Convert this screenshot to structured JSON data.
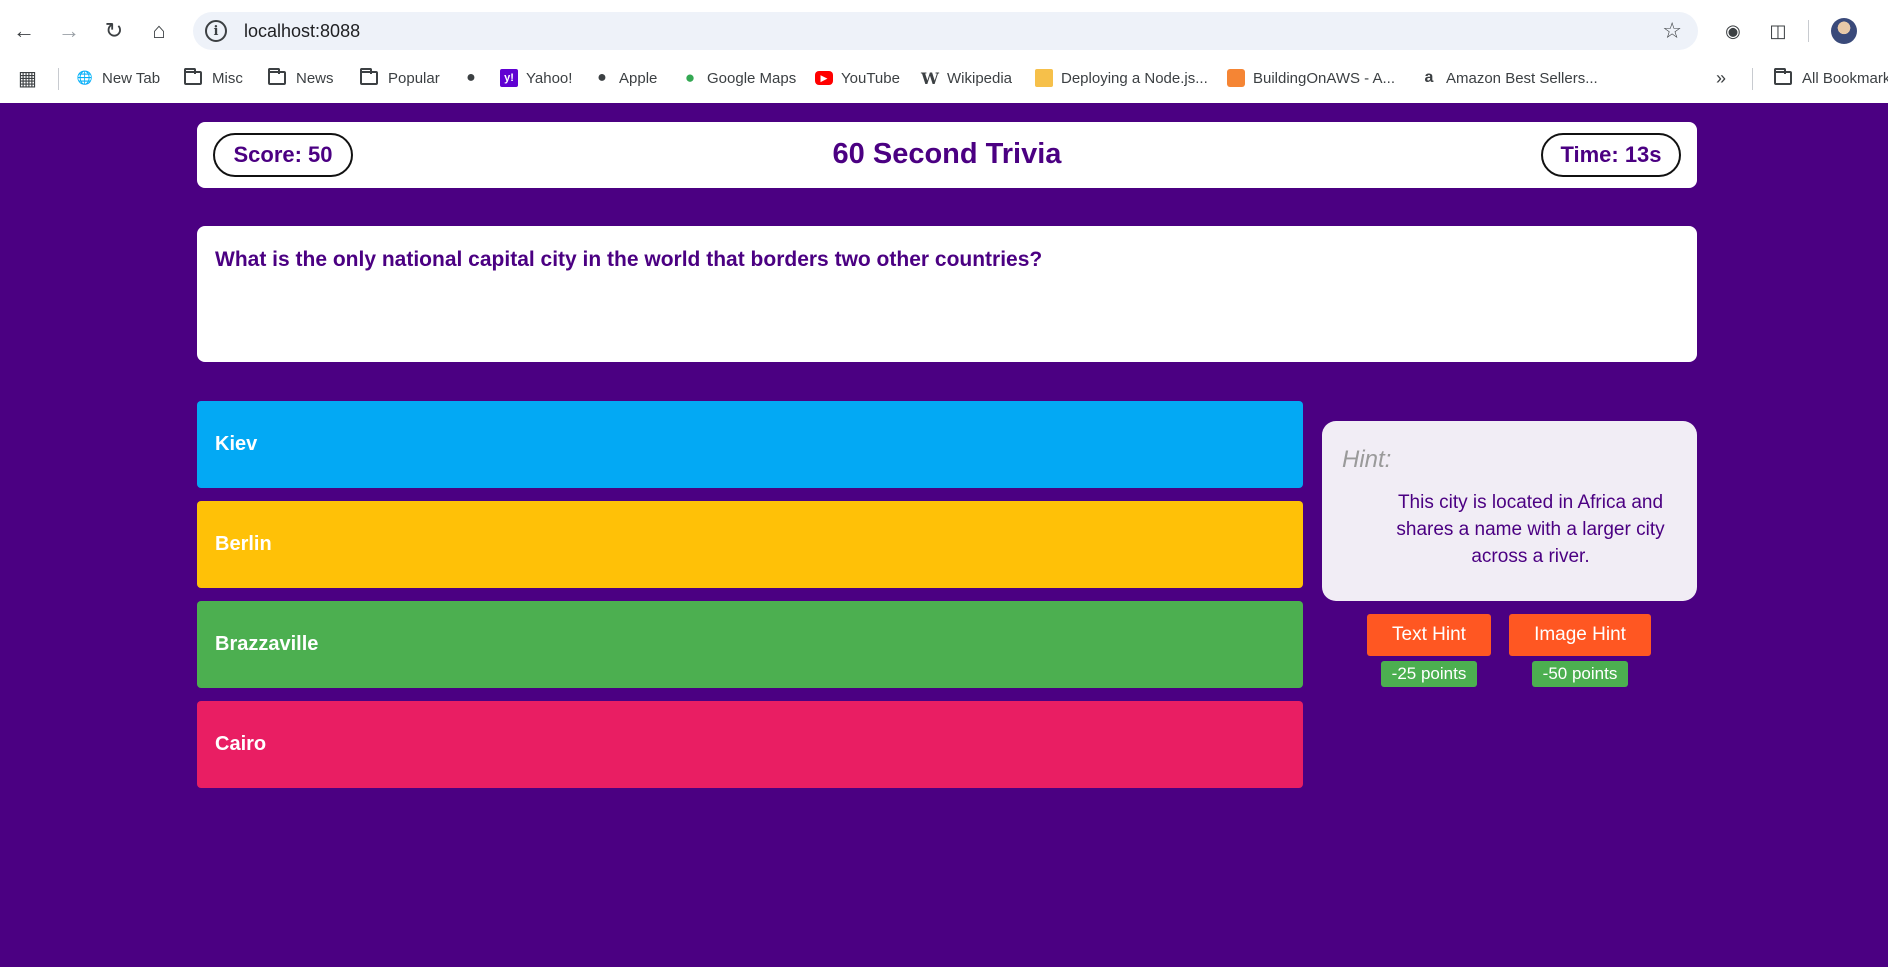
{
  "browser": {
    "url": "localhost:8088",
    "bookmarks": [
      {
        "label": "New Tab",
        "icon": "globe-icon"
      },
      {
        "label": "Misc",
        "icon": "folder-icon"
      },
      {
        "label": "News",
        "icon": "folder-icon"
      },
      {
        "label": "Popular",
        "icon": "folder-icon"
      },
      {
        "label": "",
        "icon": "apple-icon"
      },
      {
        "label": "Yahoo!",
        "icon": "yahoo-icon"
      },
      {
        "label": "Apple",
        "icon": "apple-icon"
      },
      {
        "label": "Google Maps",
        "icon": "maps-pin-icon"
      },
      {
        "label": "YouTube",
        "icon": "youtube-icon"
      },
      {
        "label": "Wikipedia",
        "icon": "wikipedia-icon"
      },
      {
        "label": "Deploying a Node.js...",
        "icon": "box-icon"
      },
      {
        "label": "BuildingOnAWS - A...",
        "icon": "aws-box-icon"
      },
      {
        "label": "Amazon Best Sellers...",
        "icon": "amazon-icon"
      }
    ],
    "all_bookmarks": "All Bookmarks"
  },
  "game": {
    "score": "Score: 50",
    "title": "60 Second Trivia",
    "time": "Time: 13s",
    "question": "What is the only national capital city in the world that borders two other countries?",
    "answers": [
      {
        "label": "Kiev",
        "color": "#03a9f4"
      },
      {
        "label": "Berlin",
        "color": "#ffc107"
      },
      {
        "label": "Brazzaville",
        "color": "#4caf50"
      },
      {
        "label": "Cairo",
        "color": "#e91e63"
      }
    ],
    "hint": {
      "label": "Hint:",
      "text": "This city is located in Africa and shares a name with a larger city across a river."
    },
    "text_hint_button": "Text Hint",
    "text_hint_cost": "-25 points",
    "image_hint_button": "Image Hint",
    "image_hint_cost": "-50 points"
  },
  "colors": {
    "background": "#4b0082",
    "hint_button": "#ff5722",
    "cost_badge": "#4caf50"
  }
}
